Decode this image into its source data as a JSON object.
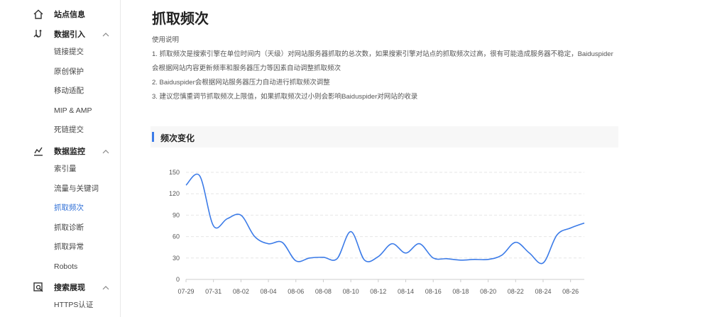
{
  "sidebar": {
    "groups": [
      {
        "label": "站点信息",
        "icon": "home-icon",
        "expanded": false,
        "items": []
      },
      {
        "label": "数据引入",
        "icon": "data-import-icon",
        "expanded": true,
        "items": [
          "链接提交",
          "原创保护",
          "移动适配",
          "MIP & AMP",
          "死链提交"
        ]
      },
      {
        "label": "数据监控",
        "icon": "data-monitor-icon",
        "expanded": true,
        "items": [
          "索引量",
          "流量与关键词",
          "抓取频次",
          "抓取诊断",
          "抓取异常",
          "Robots"
        ]
      },
      {
        "label": "搜索展现",
        "icon": "search-display-icon",
        "expanded": true,
        "items": [
          "HTTPS认证"
        ]
      }
    ],
    "active_item": "抓取频次"
  },
  "main": {
    "title": "抓取频次",
    "usage_heading": "使用说明",
    "usage_lines": [
      "1. 抓取频次是搜索引擎在单位时间内（天级）对网站服务器抓取的总次数，如果搜索引擎对站点的抓取频次过高，很有可能造成服务器不稳定，Baiduspider",
      "会根据网站内容更新频率和服务器压力等因素自动调整抓取频次",
      "2. Baiduspider会根据网站服务器压力自动进行抓取频次调整",
      "3. 建议您慎重调节抓取频次上限值，如果抓取频次过小则会影响Baiduspider对网站的收录"
    ],
    "section_title": "频次变化"
  },
  "colors": {
    "accent": "#3b7be8",
    "line": "#3b7be8",
    "active_nav": "#2f6fd6"
  },
  "chart_data": {
    "type": "line",
    "title": "",
    "xlabel": "",
    "ylabel": "",
    "ylim": [
      0,
      150
    ],
    "yticks": [
      0,
      30,
      60,
      90,
      120,
      150
    ],
    "xticks": [
      "07-29",
      "07-31",
      "08-02",
      "08-04",
      "08-06",
      "08-08",
      "08-10",
      "08-12",
      "08-14",
      "08-16",
      "08-18",
      "08-20",
      "08-22",
      "08-24",
      "08-26"
    ],
    "grid": true,
    "x": [
      "07-29",
      "07-30",
      "07-31",
      "08-01",
      "08-02",
      "08-03",
      "08-04",
      "08-05",
      "08-06",
      "08-07",
      "08-08",
      "08-09",
      "08-10",
      "08-11",
      "08-12",
      "08-13",
      "08-14",
      "08-15",
      "08-16",
      "08-17",
      "08-18",
      "08-19",
      "08-20",
      "08-21",
      "08-22",
      "08-23",
      "08-24",
      "08-25",
      "08-26",
      "08-27"
    ],
    "series": [
      {
        "values": [
          132,
          145,
          75,
          85,
          90,
          60,
          50,
          52,
          26,
          30,
          31,
          29,
          67,
          27,
          32,
          50,
          37,
          50,
          30,
          29,
          27,
          28,
          28,
          34,
          52,
          37,
          23,
          62,
          72,
          79
        ]
      }
    ]
  }
}
